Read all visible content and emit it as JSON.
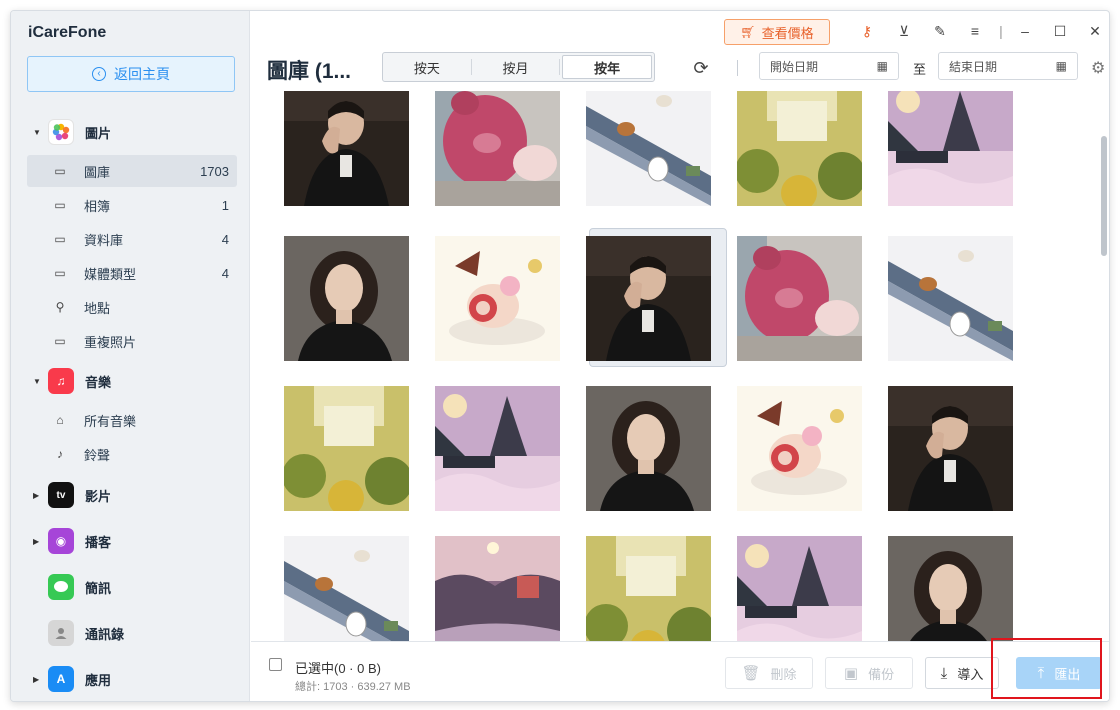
{
  "app": {
    "name": "iCareFone"
  },
  "sidebar": {
    "back_label": "返回主頁",
    "groups": [
      {
        "label": "圖片",
        "icon": "photos-app-icon"
      },
      {
        "label": "音樂",
        "icon": "music-app-icon"
      },
      {
        "label": "影片",
        "icon": "tv-app-icon"
      },
      {
        "label": "播客",
        "icon": "podcasts-app-icon"
      },
      {
        "label": "簡訊",
        "icon": "messages-app-icon"
      },
      {
        "label": "通訊錄",
        "icon": "contacts-app-icon"
      },
      {
        "label": "應用",
        "icon": "app-store-icon"
      }
    ],
    "photo_items": [
      {
        "label": "圖庫",
        "count": "1703",
        "icon": "image-icon"
      },
      {
        "label": "相簿",
        "count": "1",
        "icon": "album-icon"
      },
      {
        "label": "資料庫",
        "count": "4",
        "icon": "library-icon"
      },
      {
        "label": "媒體類型",
        "count": "4",
        "icon": "video-camera-icon"
      },
      {
        "label": "地點",
        "count": "",
        "icon": "location-pin-icon"
      },
      {
        "label": "重複照片",
        "count": "",
        "icon": "duplicate-photos-icon"
      }
    ],
    "music_items": [
      {
        "label": "所有音樂",
        "icon": "house-icon"
      },
      {
        "label": "鈴聲",
        "icon": "bell-icon"
      }
    ],
    "tv_icon_text": "tv"
  },
  "titlebar": {
    "price_label": "查看價格"
  },
  "toolbar": {
    "title": "圖庫 (1...",
    "segments": [
      "按天",
      "按月",
      "按年"
    ],
    "active_segment": "按年",
    "start_date_placeholder": "開始日期",
    "to_label": "至",
    "end_date_placeholder": "結束日期"
  },
  "footer": {
    "selected_text": "已選中(0 · 0 B)",
    "total_text": "總計: 1703 · 639.27 MB",
    "delete_label": "刪除",
    "backup_label": "備份",
    "import_label": "導入",
    "export_label": "匯出"
  },
  "colors": {
    "accent": "#2a8ff0",
    "price_orange": "#e8622c",
    "highlight_red": "#e0151d",
    "export_disabled": "#a8d4f8"
  }
}
